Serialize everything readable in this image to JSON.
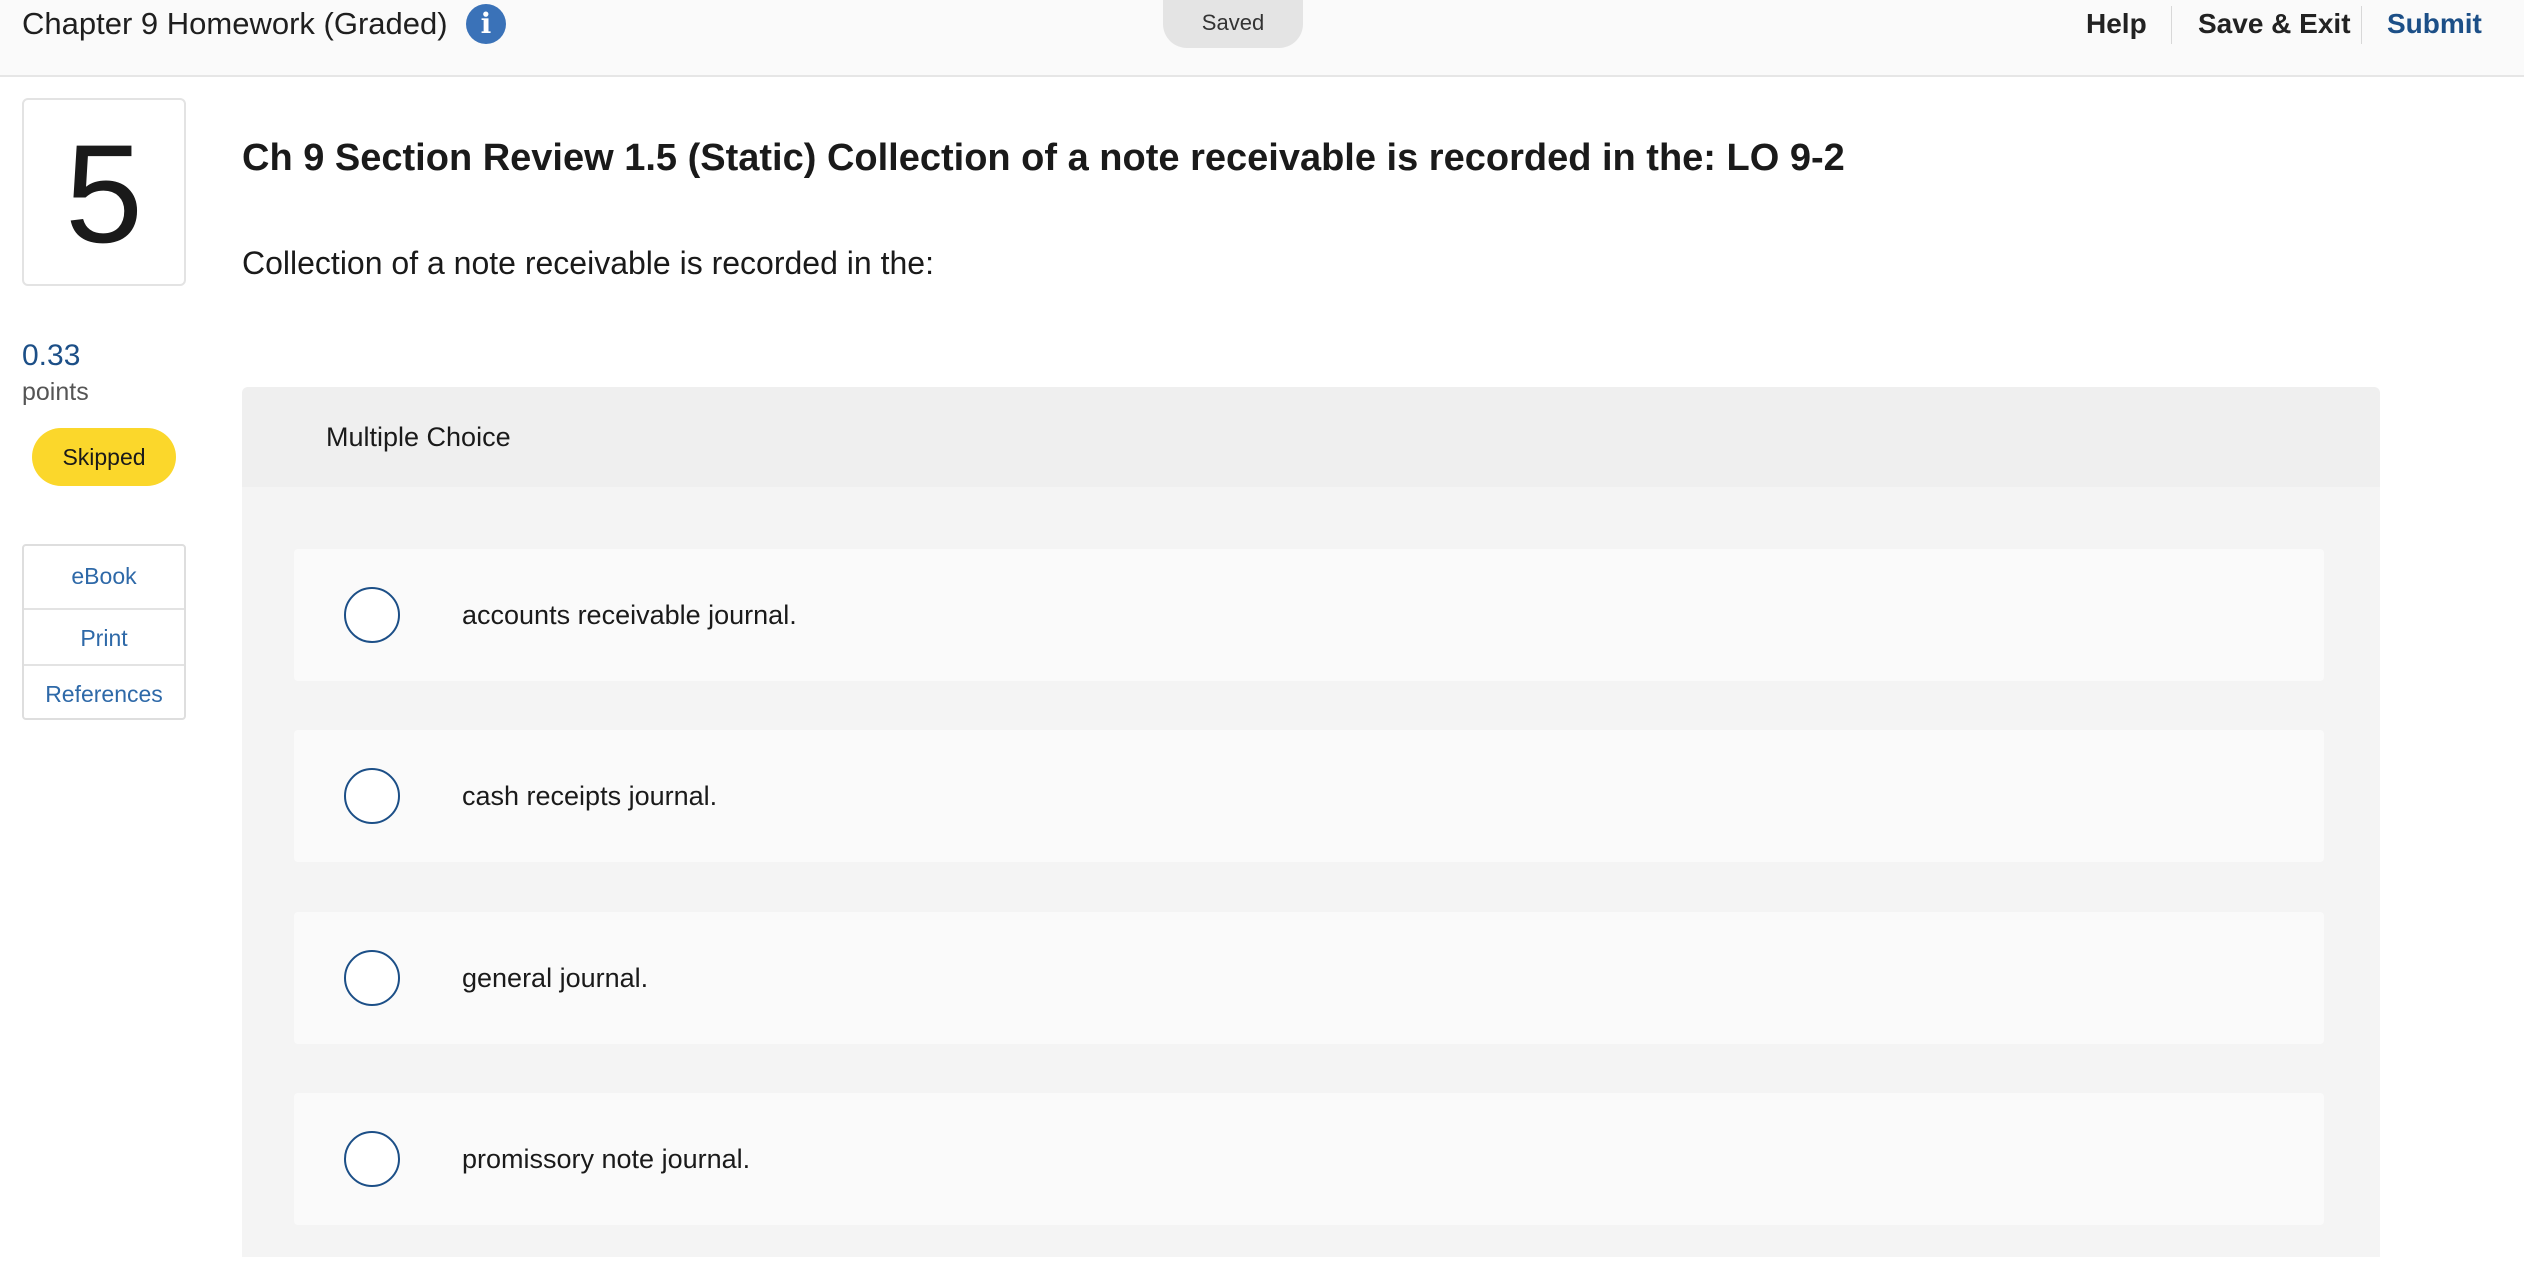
{
  "header": {
    "assignment_title": "Chapter 9 Homework (Graded)",
    "info_icon": "info-icon",
    "saved_label": "Saved",
    "help_label": "Help",
    "save_exit_label": "Save & Exit",
    "submit_label": "Submit"
  },
  "sidebar": {
    "question_number": "5",
    "points_value": "0.33",
    "points_label": "points",
    "status": "Skipped",
    "tools": [
      {
        "label": "eBook"
      },
      {
        "label": "Print"
      },
      {
        "label": "References"
      }
    ]
  },
  "question": {
    "title": "Ch 9 Section Review 1.5 (Static) Collection of a note receivable is recorded in the: LO 9-2",
    "prompt": "Collection of a note receivable is recorded in the:",
    "type_label": "Multiple Choice",
    "choices": [
      {
        "text": "accounts receivable journal.",
        "selected": false
      },
      {
        "text": "cash receipts journal.",
        "selected": false
      },
      {
        "text": "general journal.",
        "selected": false
      },
      {
        "text": "promissory note journal.",
        "selected": false
      }
    ]
  },
  "colors": {
    "accent_blue": "#1c4f87",
    "link_blue": "#2e69a8",
    "info_blue": "#3a72b8",
    "skipped_yellow": "#fbd72b"
  }
}
